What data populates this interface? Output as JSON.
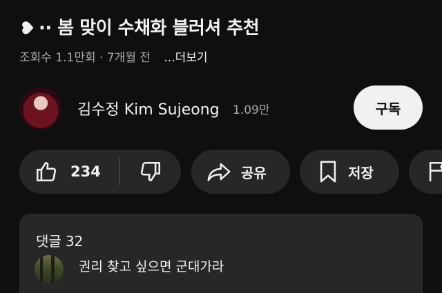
{
  "video": {
    "title": "·· 봄 맞이 수채화 블러셔 추천",
    "views": "조회수 1.1만회",
    "separator": "·",
    "age": "7개월 전",
    "more_label": "...더보기"
  },
  "channel": {
    "name": "김수정 Kim Sujeong",
    "subscribers": "1.09만",
    "subscribe_label": "구독"
  },
  "actions": {
    "like_count": "234",
    "share_label": "공유",
    "save_label": "저장"
  },
  "comments": {
    "header_label": "댓글",
    "count": "32",
    "top_comment_text": "권리 찾고 싶으면 군대가라"
  },
  "icons": {
    "title_prefix": "heart-icon",
    "like": "thumbs-up-icon",
    "dislike": "thumbs-down-icon",
    "share": "share-arrow-icon",
    "save": "bookmark-icon",
    "report": "flag-icon"
  },
  "colors": {
    "background": "#0f0f0f",
    "pill": "#272727",
    "subscribe_bg": "#f1f1f1",
    "muted_text": "#aaaaaa"
  }
}
